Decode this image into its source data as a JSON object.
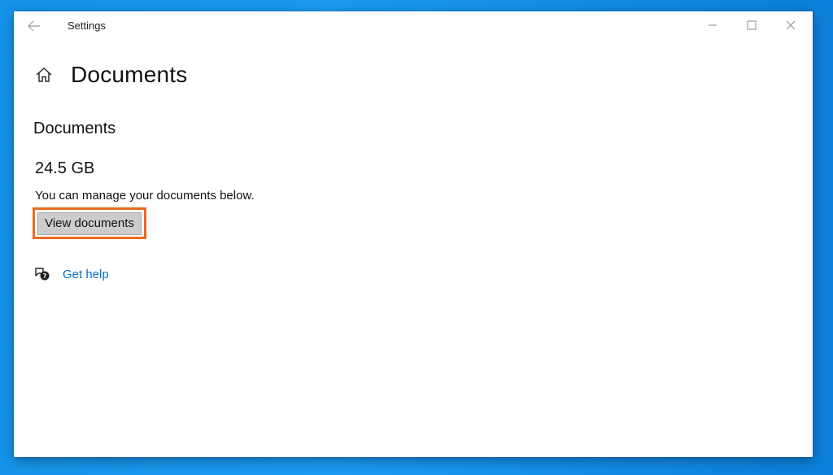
{
  "window": {
    "title": "Settings"
  },
  "page": {
    "title": "Documents"
  },
  "section": {
    "title": "Documents",
    "size": "24.5 GB",
    "description": "You can manage your documents below.",
    "button_label": "View documents"
  },
  "help": {
    "label": "Get help"
  },
  "colors": {
    "desktop_blue": "#1493e8",
    "highlight_orange": "#ec6a1c",
    "link_blue": "#0a6dc2",
    "button_gray": "#cccccc"
  },
  "icons": {
    "back": "back-arrow-icon",
    "home": "home-icon",
    "help": "help-chat-icon",
    "minimize": "minimize-icon",
    "maximize": "maximize-icon",
    "close": "close-icon"
  }
}
